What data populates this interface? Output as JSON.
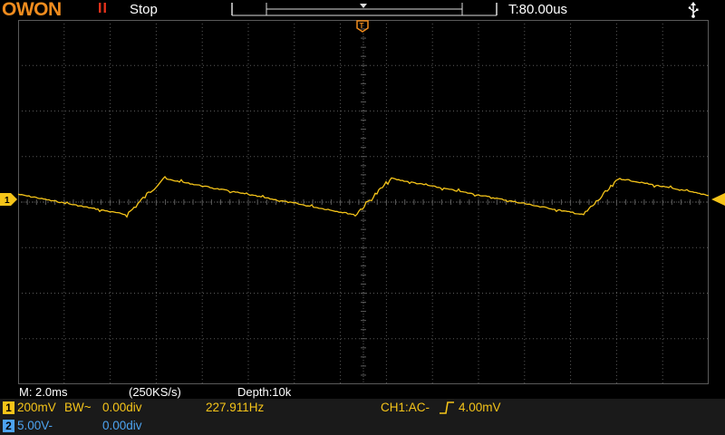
{
  "brand": "OWON",
  "run_state_symbol": "II",
  "run_state_label": "Stop",
  "trigger_time": "T:80.00us",
  "status": {
    "timebase": "M: 2.0ms",
    "sample_rate": "(250KS/s)",
    "depth": "Depth:10k"
  },
  "channel1": {
    "number": "1",
    "scale": "200mV",
    "bw_coupling": "BW~",
    "offset": "0.00div",
    "frequency": "227.911Hz",
    "trigger_info": "CH1:AC-",
    "trigger_level": "4.00mV",
    "color": "#f5c419"
  },
  "channel2": {
    "number": "2",
    "scale": "5.00V-",
    "offset": "0.00div",
    "color": "#4da3f0"
  },
  "colors": {
    "accent": "#f08c1e",
    "stop": "#e8331c",
    "grid": "#5a5a5a",
    "trace": "#f5c419"
  },
  "icons": [
    "usb-icon",
    "ch1-ground-marker-icon",
    "trigger-level-marker-icon",
    "trigger-position-marker-icon"
  ]
}
